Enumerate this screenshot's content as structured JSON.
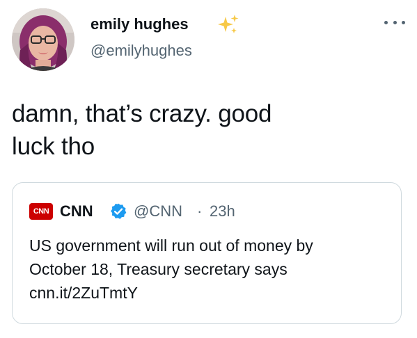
{
  "tweet": {
    "author": {
      "display_name": "emily hughes",
      "handle": "@emilyhughes"
    },
    "text": "damn, that’s crazy. good\nluck tho",
    "quote": {
      "logo_text": "CNN",
      "display_name": "CNN",
      "handle": "@CNN",
      "separator": "·",
      "time": "23h",
      "text_line1": "US government will run out of money by",
      "text_line2": "October 18, Treasury secretary says",
      "link": "cnn.it/2ZuTmtY"
    }
  },
  "colors": {
    "text": "#0f1419",
    "secondary": "#536471",
    "border": "#cfd9de",
    "verified": "#1d9bf0",
    "cnn_red": "#cc0000",
    "sparkles": "#f7c948"
  },
  "icons": [
    "sparkles-icon",
    "more-icon",
    "verified-icon",
    "cnn-logo"
  ]
}
